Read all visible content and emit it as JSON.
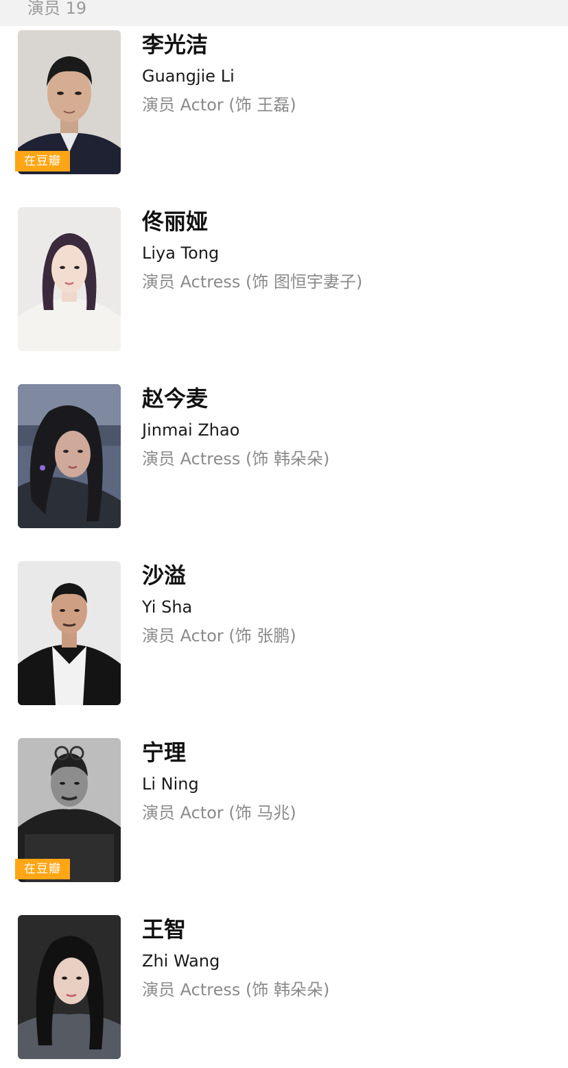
{
  "section": {
    "label": "演员 19"
  },
  "cast": [
    {
      "name_cn": "李光洁",
      "name_en": "Guangjie Li",
      "role": "演员 Actor (饰 王磊)",
      "badge": "在豆瓣"
    },
    {
      "name_cn": "佟丽娅",
      "name_en": "Liya Tong",
      "role": "演员 Actress (饰 图恒宇妻子)"
    },
    {
      "name_cn": "赵今麦",
      "name_en": "Jinmai Zhao",
      "role": "演员 Actress (饰 韩朵朵)"
    },
    {
      "name_cn": "沙溢",
      "name_en": "Yi Sha",
      "role": "演员 Actor (饰 张鹏)"
    },
    {
      "name_cn": "宁理",
      "name_en": "Li Ning",
      "role": "演员 Actor (饰 马兆)",
      "badge": "在豆瓣"
    },
    {
      "name_cn": "王智",
      "name_en": "Zhi Wang",
      "role": "演员 Actress (饰 韩朵朵)"
    }
  ],
  "colors": {
    "badge": "#ffa617",
    "header_bg": "#f2f2f2",
    "role_text": "#8a8a8a"
  }
}
